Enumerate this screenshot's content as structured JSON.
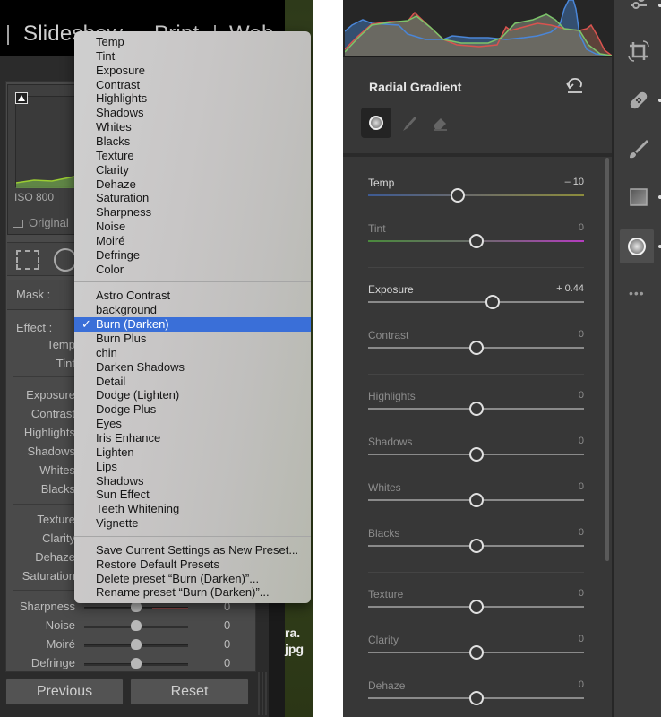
{
  "left_panel": {
    "module_nav": [
      "Slideshow",
      "Print",
      "Web"
    ],
    "module_nav_visible": [
      "| Slides",
      "| Print",
      "| Web"
    ],
    "iso": "ISO 800",
    "original_label": "Original",
    "mask_label": "Mask :",
    "effect_label": "Effect :",
    "photo_caption": [
      "ra.",
      "jpg"
    ],
    "sliders": [
      {
        "label": "Temp"
      },
      {
        "label": "Tint"
      },
      {
        "label": "Exposure"
      },
      {
        "label": "Contrast"
      },
      {
        "label": "Highlights"
      },
      {
        "label": "Shadows"
      },
      {
        "label": "Whites"
      },
      {
        "label": "Blacks"
      },
      {
        "label": "Texture"
      },
      {
        "label": "Clarity"
      },
      {
        "label": "Dehaze"
      },
      {
        "label": "Saturation"
      },
      {
        "label": "Sharpness",
        "value": "0"
      },
      {
        "label": "Noise",
        "value": "0"
      },
      {
        "label": "Moiré",
        "value": "0"
      },
      {
        "label": "Defringe",
        "value": "0"
      }
    ],
    "buttons": {
      "previous": "Previous",
      "reset": "Reset"
    }
  },
  "effect_menu": {
    "group_settings": [
      "Temp",
      "Tint",
      "Exposure",
      "Contrast",
      "Highlights",
      "Shadows",
      "Whites",
      "Blacks",
      "Texture",
      "Clarity",
      "Dehaze",
      "Saturation",
      "Sharpness",
      "Noise",
      "Moiré",
      "Defringe",
      "Color"
    ],
    "group_presets": [
      "Astro Contrast",
      "background",
      "Burn (Darken)",
      "Burn Plus",
      "chin",
      "Darken Shadows",
      "Detail",
      "Dodge (Lighten)",
      "Dodge Plus",
      "Eyes",
      "Iris Enhance",
      "Lighten",
      "Lips",
      "Shadows",
      "Sun Effect",
      "Teeth Whitening",
      "Vignette"
    ],
    "selected": "Burn (Darken)",
    "checkmark": "✓",
    "group_actions": [
      "Save Current Settings as New Preset...",
      "Restore Default Presets",
      "Delete preset “Burn (Darken)”...",
      "Rename preset “Burn (Darken)”..."
    ]
  },
  "right_panel": {
    "title": "Radial Gradient",
    "tools": [
      "radial-tool",
      "brush-tool",
      "eraser-tool"
    ],
    "side_tools": [
      "edit-sliders",
      "crop",
      "healing",
      "brush",
      "linear-gradient",
      "radial-gradient",
      "more"
    ],
    "more_label": "•••",
    "sliders": [
      {
        "label": "Temp",
        "value": "– 10",
        "position": -0.1,
        "highlight": true,
        "track": "temp"
      },
      {
        "label": "Tint",
        "value": "0",
        "position": 0,
        "highlight": false,
        "track": "tint"
      },
      {
        "label": "Exposure",
        "value": "+ 0.44",
        "position": 0.09,
        "highlight": true,
        "track": "plain"
      },
      {
        "label": "Contrast",
        "value": "0",
        "position": 0,
        "highlight": false,
        "track": "plain"
      },
      {
        "label": "Highlights",
        "value": "0",
        "position": 0,
        "highlight": false,
        "track": "plain"
      },
      {
        "label": "Shadows",
        "value": "0",
        "position": 0,
        "highlight": false,
        "track": "plain"
      },
      {
        "label": "Whites",
        "value": "0",
        "position": 0,
        "highlight": false,
        "track": "plain"
      },
      {
        "label": "Blacks",
        "value": "0",
        "position": 0,
        "highlight": false,
        "track": "plain"
      },
      {
        "label": "Texture",
        "value": "0",
        "position": 0,
        "highlight": false,
        "track": "plain"
      },
      {
        "label": "Clarity",
        "value": "0",
        "position": 0,
        "highlight": false,
        "track": "plain"
      },
      {
        "label": "Dehaze",
        "value": "0",
        "position": 0,
        "highlight": false,
        "track": "plain"
      }
    ],
    "histogram_colors": {
      "red": "#d9534f",
      "green": "#7cc46a",
      "blue": "#4a86d8"
    }
  }
}
